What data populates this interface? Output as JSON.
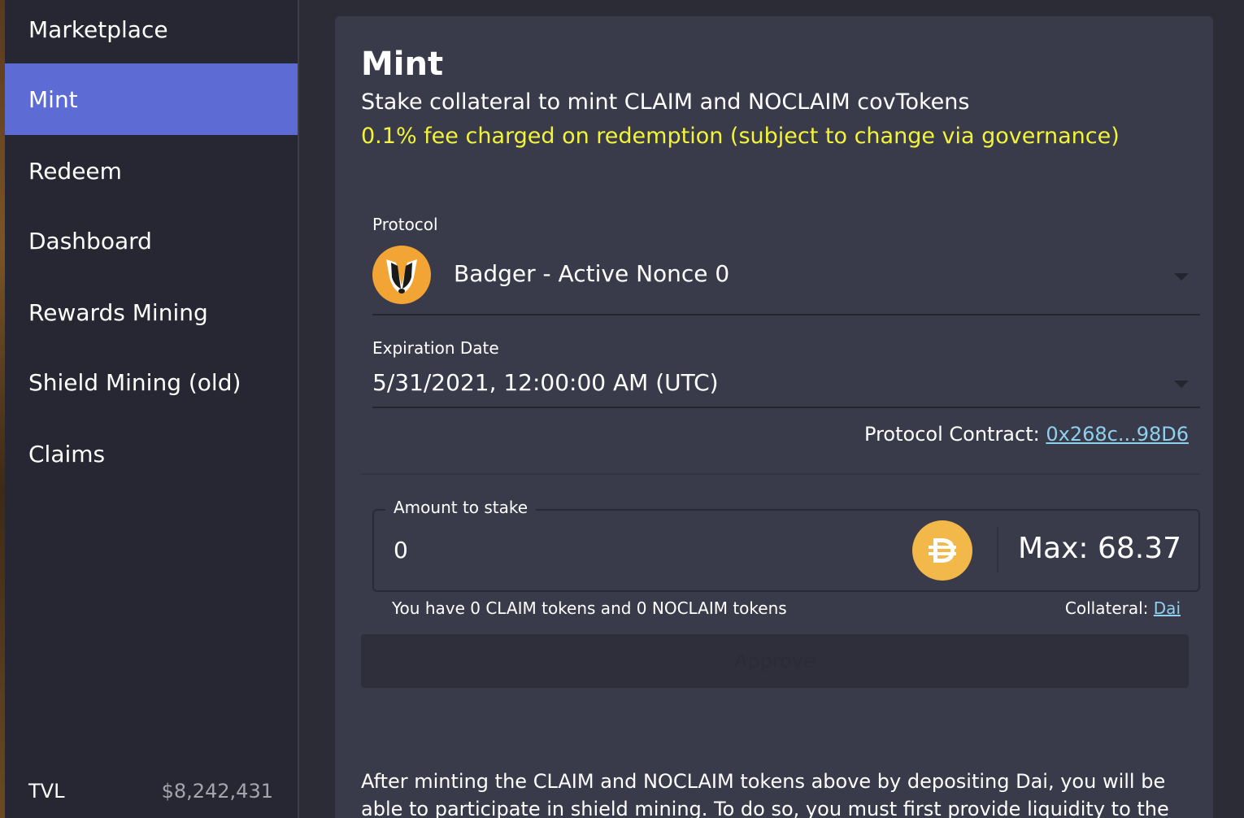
{
  "sidebar": {
    "items": [
      {
        "label": "Marketplace"
      },
      {
        "label": "Mint"
      },
      {
        "label": "Redeem"
      },
      {
        "label": "Dashboard"
      },
      {
        "label": "Rewards Mining"
      },
      {
        "label": "Shield Mining (old)"
      },
      {
        "label": "Claims"
      }
    ],
    "active_item": "Mint",
    "tvl_label": "TVL",
    "tvl_value": "$8,242,431"
  },
  "main": {
    "title": "Mint",
    "subtitle": "Stake collateral to mint CLAIM and NOCLAIM covTokens",
    "fee_notice": "0.1% fee charged on redemption (subject to change via governance)",
    "protocol": {
      "label": "Protocol",
      "selected": "Badger - Active Nonce 0",
      "icon": "badger-icon"
    },
    "expiration": {
      "label": "Expiration Date",
      "selected": "5/31/2021, 12:00:00 AM (UTC)"
    },
    "contract": {
      "label": "Protocol Contract: ",
      "address": "0x268c...98D6"
    },
    "stake": {
      "label": "Amount to stake",
      "value": "0",
      "token_icon": "dai-icon",
      "max_label": "Max: 68.37"
    },
    "balance_text": "You have 0 CLAIM tokens and 0 NOCLAIM tokens",
    "collateral": {
      "label": "Collateral: ",
      "token": "Dai"
    },
    "approve_label": "Approve",
    "info_text": "After minting the CLAIM and NOCLAIM tokens above by depositing Dai, you will be able to participate in shield mining. To do so, you must first provide liquidity to the"
  },
  "colors": {
    "accent": "#5d6bd5",
    "fee_text": "#f3f43a",
    "link": "#8fd0ee",
    "panel": "#3a3b4a",
    "sidebar": "#262732"
  }
}
